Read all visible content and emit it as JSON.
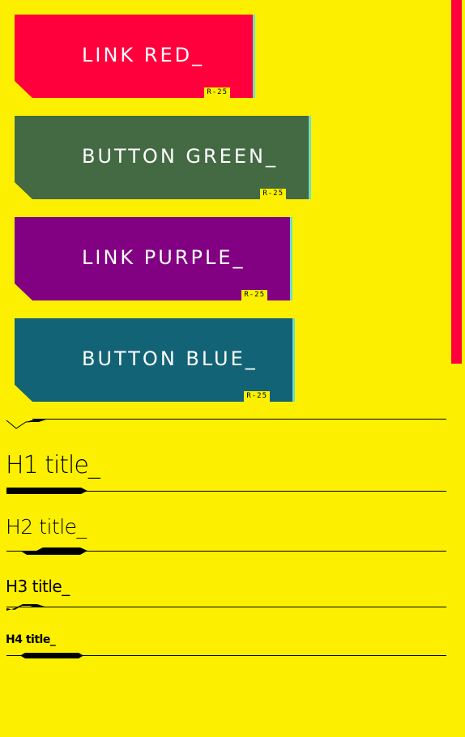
{
  "buttons": {
    "red": {
      "label": "LINK RED_",
      "tag": "R-25",
      "color": "#ff003c"
    },
    "green": {
      "label": "BUTTON GREEN_",
      "tag": "R-25",
      "color": "#446a44"
    },
    "purple": {
      "label": "LINK PURPLE_",
      "tag": "R-25",
      "color": "#820082"
    },
    "blue": {
      "label": "BUTTON BLUE_",
      "tag": "R-25",
      "color": "#136377"
    }
  },
  "headings": {
    "h1": "H1 title_",
    "h2": "H2 title_",
    "h3": "H3 title_",
    "h4": "H4 title_"
  },
  "colors": {
    "background": "#fcf000",
    "accent_edge": "#6ee0c4",
    "scrollbar": "#ff003c",
    "text": "#000000"
  }
}
